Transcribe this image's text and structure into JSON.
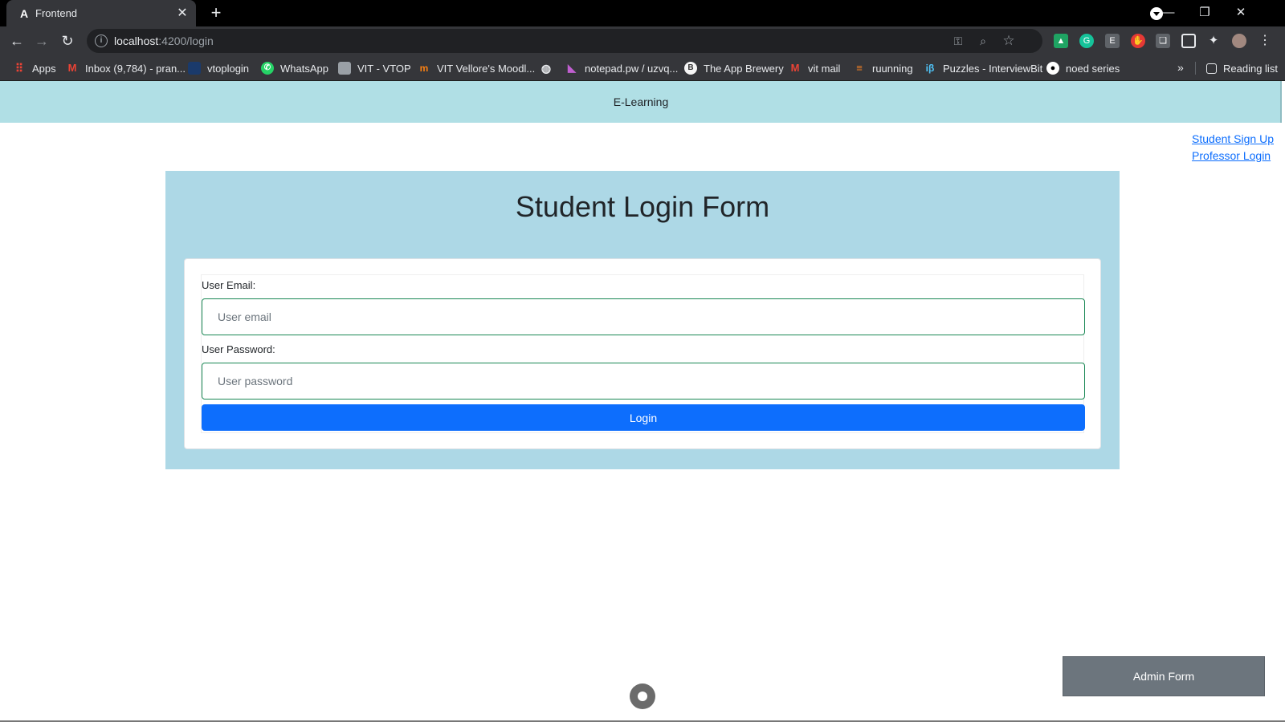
{
  "browser": {
    "tab_title": "Frontend",
    "tab_favicon_glyph": "A",
    "url_host": "localhost",
    "url_path": ":4200/login",
    "bookmarks": [
      {
        "label": "Apps",
        "icon": "apps-grid-icon",
        "color": "#ea4335"
      },
      {
        "label": "Inbox (9,784) - pran...",
        "icon": "gmail-icon",
        "color": "#ea4335"
      },
      {
        "label": "vtoplogin",
        "icon": "vtop-icon",
        "color": "#1a3a6b"
      },
      {
        "label": "WhatsApp",
        "icon": "whatsapp-icon",
        "color": "#25d366"
      },
      {
        "label": "VIT - VTOP",
        "icon": "vtop-page-icon",
        "color": "#9aa0a6"
      },
      {
        "label": "VIT Vellore's Moodl...",
        "icon": "moodle-icon",
        "color": "#f98012"
      },
      {
        "label": "",
        "icon": "globe-icon",
        "color": "#e8eaed"
      },
      {
        "label": "notepad.pw / uzvq...",
        "icon": "notepad-icon",
        "color": "#c05fd0"
      },
      {
        "label": "The App Brewery",
        "icon": "app-brewery-icon",
        "color": "#f5f5f5"
      },
      {
        "label": "vit mail",
        "icon": "gmail-icon",
        "color": "#ea4335"
      },
      {
        "label": "ruunning",
        "icon": "stack-icon",
        "color": "#f48024"
      },
      {
        "label": "Puzzles - InterviewBit",
        "icon": "interviewbit-icon",
        "color": "#4fc3f7"
      },
      {
        "label": "noed series",
        "icon": "github-icon",
        "color": "#ffffff"
      }
    ],
    "reading_list": "Reading list"
  },
  "navbar": {
    "brand": "E-Learning"
  },
  "links": {
    "student_signup": "Student Sign Up",
    "professor_login": "Professor Login"
  },
  "form": {
    "title": "Student Login Form",
    "email_label": "User Email:",
    "email_placeholder": "User email",
    "email_value": "",
    "password_label": "User Password:",
    "password_placeholder": "User password",
    "password_value": "",
    "login_label": "Login"
  },
  "admin": {
    "label": "Admin Form"
  },
  "colors": {
    "navbar_bg": "#b0dfe5",
    "card_bg": "#add8e6",
    "primary": "#0d6efd",
    "input_border": "#198754",
    "secondary": "#6c757d"
  }
}
